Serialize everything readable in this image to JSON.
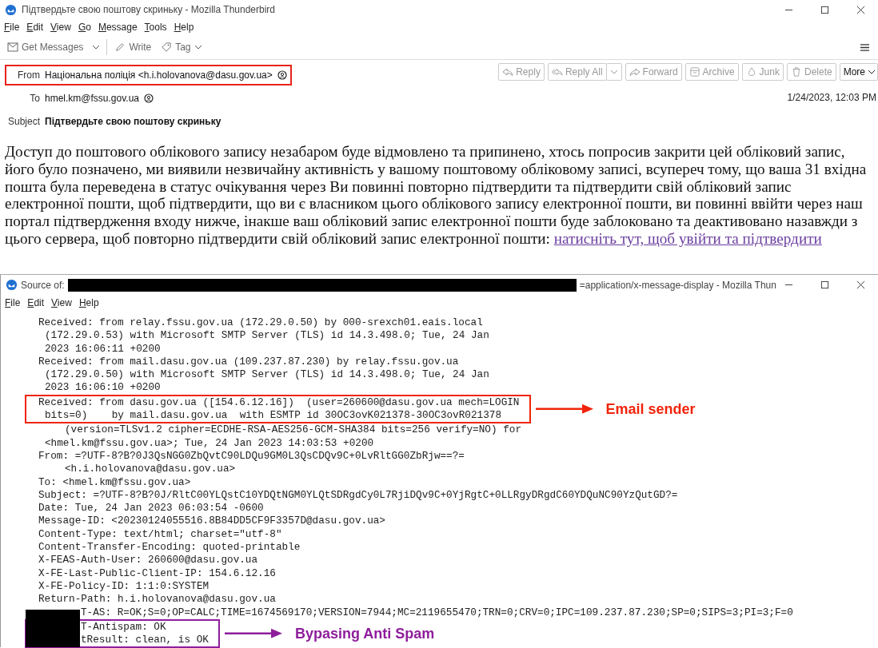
{
  "window": {
    "title": "Підтвердьте свою поштову скриньку - Mozilla Thunderbird"
  },
  "menu": [
    "File",
    "Edit",
    "View",
    "Go",
    "Message",
    "Tools",
    "Help"
  ],
  "toolbar": [
    {
      "kind": "get",
      "label": "Get Messages"
    },
    {
      "kind": "dropdown"
    },
    {
      "kind": "write",
      "label": "Write"
    },
    {
      "kind": "tag",
      "label": "Tag"
    }
  ],
  "actions": [
    {
      "kind": "reply",
      "label": "Reply"
    },
    {
      "kind": "reply-all",
      "label": "Reply All"
    },
    {
      "kind": "forward",
      "label": "Forward"
    },
    {
      "kind": "archive",
      "label": "Archive"
    },
    {
      "kind": "junk",
      "label": "Junk"
    },
    {
      "kind": "delete",
      "label": "Delete"
    },
    {
      "kind": "more",
      "label": "More"
    }
  ],
  "header": {
    "fields": [
      {
        "kind": "contact",
        "label": "From",
        "value": "Національна поліція <h.i.holovanova@dasu.gov.ua>",
        "annotated": true
      },
      {
        "kind": "contact",
        "label": "To",
        "value": "hmel.km@fssu.gov.ua",
        "annotated": false
      },
      {
        "kind": "subject",
        "label": "Subject",
        "value": "Підтвердьте свою поштову скриньку",
        "annotated": false
      }
    ],
    "date": "1/24/2023, 12:03 PM"
  },
  "body": {
    "text": "Доступ до поштового облікового запису незабаром буде відмовлено та припинено, хтось попросив закрити цей обліковий запис, його було позначено, ми виявили незвичайну активність у вашому поштовому обліковому записі, всупереч тому, що ваша 31 вхідна пошта була переведена в статус очікування через Ви повинні повторно підтвердити та підтвердити свій обліковий запис електронної пошти, щоб підтвердити, що ви є власником цього облікового запису електронної пошти, ви повинні ввійти через наш портал підтвердження входу нижче, інакше ваш обліковий запис електронної пошти буде заблоковано та деактивовано назавжди з цього сервера, щоб повторно підтвердити свій обліковий запис електронної пошти:",
    "link": "натисніть тут, щоб увійти та підтвердити"
  },
  "source_window": {
    "title_prefix": "Source of:",
    "title_suffix": "=application/x-message-display - Mozilla Thun",
    "menu": [
      "File",
      "Edit",
      "View",
      "Help"
    ],
    "blocks": [
      {
        "lines": [
          {
            "kind": "field",
            "text": "Received: from relay.fssu.gov.ua (172.29.0.50) by 000-srexch01.eais.local"
          },
          {
            "kind": "continuation",
            "text": "(172.29.0.53) with Microsoft SMTP Server (TLS) id 14.3.498.0; Tue, 24 Jan"
          },
          {
            "kind": "continuation",
            "text": "2023 16:06:11 +0200"
          },
          {
            "kind": "field",
            "text": "Received: from mail.dasu.gov.ua (109.237.87.230) by relay.fssu.gov.ua"
          },
          {
            "kind": "continuation",
            "text": "(172.29.0.50) with Microsoft SMTP Server (TLS) id 14.3.498.0; Tue, 24 Jan"
          },
          {
            "kind": "continuation",
            "text": "2023 16:06:10 +0200"
          }
        ]
      },
      {
        "annotation": {
          "label": "Email sender",
          "color": "#f0240a"
        },
        "lines": [
          {
            "kind": "field",
            "text": "Received: from dasu.gov.ua ([154.6.12.16])  (user=260600@dasu.gov.ua mech=LOGIN"
          },
          {
            "kind": "continuation",
            "text": "bits=0)    by mail.dasu.gov.ua  with ESMTP id 30OC3ovK021378-30OC3ovR021378"
          }
        ]
      },
      {
        "lines": [
          {
            "kind": "wrapped",
            "text": "(version=TLSv1.2 cipher=ECDHE-RSA-AES256-GCM-SHA384 bits=256 verify=NO) for"
          },
          {
            "kind": "continuation",
            "text": "<hmel.km@fssu.gov.ua>; Tue, 24 Jan 2023 14:03:53 +0200"
          },
          {
            "kind": "field",
            "text": "From: =?UTF-8?B?0J3QsNGG0ZbQvtC90LDQu9GM0L3QsCDQv9C+0LvRltGG0ZbRjw==?="
          },
          {
            "kind": "wrapped",
            "text": "<h.i.holovanova@dasu.gov.ua>"
          },
          {
            "kind": "field",
            "text": "To: <hmel.km@fssu.gov.ua>"
          },
          {
            "kind": "field",
            "text": "Subject: =?UTF-8?B?0J/RltC00YLQstC10YDQtNGM0YLQtSDRgdCy0L7RjiDQv9C+0YjRgtC+0LLRgyDRgdC60YDQuNC90YzQutGD?="
          },
          {
            "kind": "field",
            "text": "Date: Tue, 24 Jan 2023 06:03:54 -0600"
          },
          {
            "kind": "field",
            "text": "Message-ID: <20230124055516.8B84DD5CF9F3357D@dasu.gov.ua>"
          },
          {
            "kind": "field",
            "text": "Content-Type: text/html; charset=\"utf-8\""
          },
          {
            "kind": "field",
            "text": "Content-Transfer-Encoding: quoted-printable"
          },
          {
            "kind": "field",
            "text": "X-FEAS-Auth-User: 260600@dasu.gov.ua"
          },
          {
            "kind": "field",
            "text": "X-FE-Last-Public-Client-IP: 154.6.12.16"
          },
          {
            "kind": "field",
            "text": "X-FE-Policy-ID: 1:1:0:SYSTEM"
          },
          {
            "kind": "field",
            "text": "Return-Path: h.i.holovanova@dasu.gov.ua"
          },
          {
            "kind": "redacted",
            "text": "T-AS: R=OK;S=0;OP=CALC;TIME=1674569170;VERSION=7944;MC=2119655470;TRN=0;CRV=0;IPC=109.237.87.230;SP=0;SIPS=3;PI=3;F=0"
          }
        ]
      },
      {
        "annotation": {
          "label": "Bypasing Anti Spam",
          "color": "#8e1d9c"
        },
        "lines": [
          {
            "kind": "redacted",
            "text": "T-Antispam: OK"
          },
          {
            "kind": "redacted",
            "text": "tResult: clean, is OK"
          }
        ]
      }
    ]
  }
}
